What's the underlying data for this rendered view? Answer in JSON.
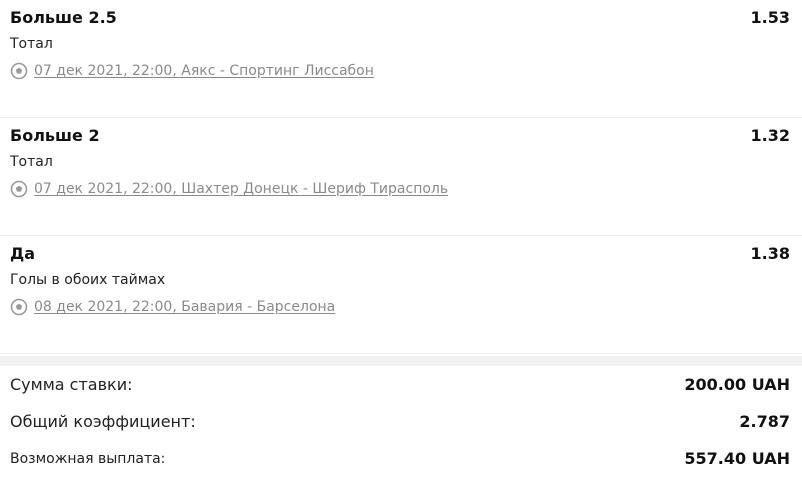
{
  "bets": [
    {
      "selection": "Больше 2.5",
      "odds": "1.53",
      "market": "Тотал",
      "event": "07 дек 2021, 22:00, Аякс - Спортинг Лиссабон",
      "icon": "soccer-ball-icon"
    },
    {
      "selection": "Больше 2",
      "odds": "1.32",
      "market": "Тотал",
      "event": "07 дек 2021, 22:00, Шахтер Донецк - Шериф Тирасполь",
      "icon": "soccer-ball-icon"
    },
    {
      "selection": "Да",
      "odds": "1.38",
      "market": "Голы в обоих таймах",
      "event": "08 дек 2021, 22:00, Бавария - Барселона",
      "icon": "soccer-ball-icon"
    }
  ],
  "summary": {
    "stake_label": "Сумма ставки:",
    "stake_value": "200.00 UAH",
    "total_odds_label": "Общий коэффициент:",
    "total_odds_value": "2.787",
    "payout_label": "Возможная выплата:",
    "payout_value": "557.40 UAH"
  },
  "colors": {
    "link_gray": "#8a8a8a",
    "band": "#f1f1f1"
  }
}
